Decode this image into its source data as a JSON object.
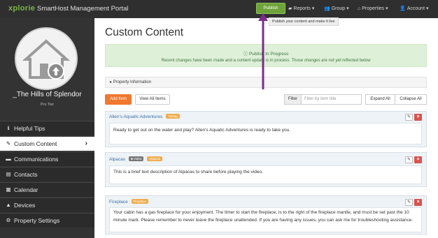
{
  "topbar": {
    "logo": "xplorie",
    "app_title": "SmartHost Management Portal",
    "publish_label": "Publish",
    "publish_tooltip": "Publish your content and make it live",
    "nav": [
      {
        "icon": "folder-icon",
        "glyph": "▰",
        "label": "Reports ▾"
      },
      {
        "icon": "users-icon",
        "glyph": "👥",
        "label": "Group ▾"
      },
      {
        "icon": "home-icon",
        "glyph": "⌂",
        "label": "Properties ▾"
      },
      {
        "icon": "user-icon",
        "glyph": "👤",
        "label": "Account ▾"
      }
    ]
  },
  "sidebar": {
    "property_name": "_The Hills of Splendor",
    "tier": "Pro Tier",
    "items": [
      {
        "label": "Helpful Tips",
        "icon": "info-icon",
        "glyph": "ℹ",
        "active": false
      },
      {
        "label": "Custom Content",
        "icon": "pencil-icon",
        "glyph": "✎",
        "active": true
      },
      {
        "label": "Communications",
        "icon": "comment-icon",
        "glyph": "▬",
        "active": false
      },
      {
        "label": "Contacts",
        "icon": "contacts-icon",
        "glyph": "▤",
        "active": false
      },
      {
        "label": "Calendar",
        "icon": "calendar-icon",
        "glyph": "▦",
        "active": false
      },
      {
        "label": "Devices",
        "icon": "bell-icon",
        "glyph": "▲",
        "active": false
      },
      {
        "label": "Property Settings",
        "icon": "gear-icon",
        "glyph": "⚙",
        "active": false
      }
    ]
  },
  "main": {
    "title": "Custom Content",
    "alert": {
      "title": "Publish In Progress",
      "message": "Recent changes have been made and a content update is in process. Those changes are not yet reflected below"
    },
    "property_info_label": "Property Information",
    "add_item_label": "Add Item",
    "view_all_label": "View All Items",
    "filter_label": "Filter",
    "filter_placeholder": "Filter by item title",
    "expand_all_label": "Expand All",
    "collapse_all_label": "Collapse All",
    "cards": [
      {
        "title": "Allen's Aquatic Adventures",
        "badges": [
          {
            "text": "Tubing",
            "color": "orange"
          }
        ],
        "body": "Ready to get out on the water and play? Allen's Aquatic Adventures is ready to take you."
      },
      {
        "title": "Alpacas",
        "badges": [
          {
            "text": "Video",
            "color": "gray"
          },
          {
            "text": "Alpacas",
            "color": "orange"
          }
        ],
        "body": "This is a brief text description of Alpacas to share before playing the video."
      },
      {
        "title": "Fireplace",
        "badges": [
          {
            "text": "Fireplace",
            "color": "orange"
          }
        ],
        "body": "Your cabin has a gas fireplace for your enjoyment. The timer to start the fireplace, is to the right of the fireplace mantle, and must be set past the 10 minute mark. Please remember to never leave the fireplace unattended. If you are having any issues, you can ask me for troubleshooting assistance."
      }
    ]
  },
  "colors": {
    "accent_orange": "#f0782f",
    "publish_green": "#6ea33a",
    "annotation_arrow": "#7b2d8e"
  }
}
